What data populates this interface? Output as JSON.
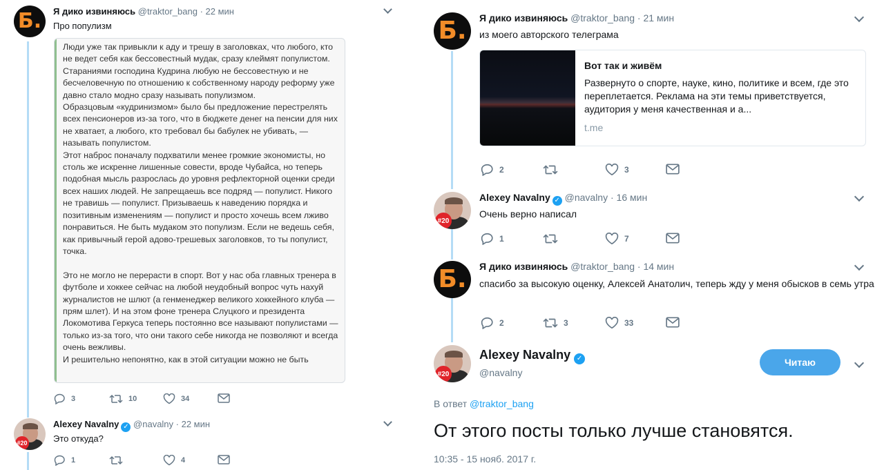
{
  "left": {
    "tweet1": {
      "name": "Я дико извиняюсь",
      "handle": "@traktor_bang",
      "time": "· 22 мин",
      "text": "Про популизм",
      "avatar_letter": "Б.",
      "note": "Люди уже так привыкли к аду и трешу в заголовках, что любого, кто не ведет себя как бессовестный мудак, сразу клеймят популистом. Стараниями господина Кудрина любую не бессовестную и не бесчеловечную по отношению к собственному народу реформу уже давно стало модно сразу называть популизмом.\nОбразцовым «кудринизмом» было бы предложение перестрелять всех пенсионеров из-за того, что в бюджете денег на пенсии для них не хватает, а любого, кто требовал бы бабулек не убивать, — называть популистом.\n Этот наброс поначалу подхватили менее громкие экономисты, но столь же искренне лишенные совести, вроде Чубайса, но теперь подобная мысль разрослась до уровня рефлекторной оценки среди всех наших людей. Не запрещаешь все подряд — популист. Никого не травишь — популист. Призываешь к наведению порядка и позитивным изменениям — популист и просто хочешь всем лживо понравиться. Не быть мудаком это популизм. Если не ведешь себя, как привычный герой адово-трешевых заголовков, то ты популист, точка.\n\nЭто не могло не перерасти в спорт. Вот у нас оба главных тренера в футболе и хоккее сейчас на любой неудобный вопрос чуть нахуй журналистов не шлют (а генменеджер великого хоккейного клуба — прям шлет). И на этом фоне тренера Слуцкого и президента Локомотива Геркуса теперь постоянно все называют популистами — только из-за того, что они такого себе никогда не позволяют и всегда очень вежливы.\nИ решительно непонятно, как в этой ситуации можно не быть",
      "replies": "3",
      "retweets": "10",
      "likes": "34"
    },
    "tweet2": {
      "name": "Alexey Navalny",
      "handle": "@navalny",
      "time": "· 22 мин",
      "text": "Это откуда?",
      "badge": "#20",
      "replies": "1",
      "retweets": "",
      "likes": "4"
    }
  },
  "right": {
    "tweet1": {
      "name": "Я дико извиняюсь",
      "handle": "@traktor_bang",
      "time": "· 21 мин",
      "text": "из моего авторского телеграма",
      "avatar_letter": "Б.",
      "card": {
        "title": "Вот так и живём",
        "description": "Развернуто о спорте, науке, кино, политике и всем, где это переплетается. Реклама на эти темы приветствуется, аудитория у меня качественная и а...",
        "domain": "t.me"
      },
      "replies": "2",
      "retweets": "",
      "likes": "3"
    },
    "tweet2": {
      "name": "Alexey Navalny",
      "handle": "@navalny",
      "time": "· 16 мин",
      "text": "Очень верно написал",
      "badge": "#20",
      "replies": "1",
      "retweets": "",
      "likes": "7"
    },
    "tweet3": {
      "name": "Я дико извиняюсь",
      "handle": "@traktor_bang",
      "time": "· 14 мин",
      "text": "спасибо за высокую оценку, Алексей Анатолич, теперь жду у меня обысков в семь утра",
      "avatar_letter": "Б.",
      "replies": "2",
      "retweets": "3",
      "likes": "33"
    },
    "main": {
      "name": "Alexey Navalny",
      "handle": "@navalny",
      "badge": "#20",
      "follow_label": "Читаю",
      "reply_prefix": "В ответ",
      "reply_handle": "@traktor_bang",
      "text": "От этого посты только лучше становятся.",
      "timestamp": "10:35 - 15 нояб. 2017 г."
    }
  },
  "colors": {
    "accent": "#1da1f2",
    "thread_line": "#b4dcf6",
    "secondary_text": "#657786",
    "avatar_letter": "#f28c28",
    "badge_red": "#e0242a"
  },
  "icons": [
    "reply-icon",
    "retweet-icon",
    "like-icon",
    "message-icon",
    "chevron-down-icon",
    "verified-icon"
  ]
}
